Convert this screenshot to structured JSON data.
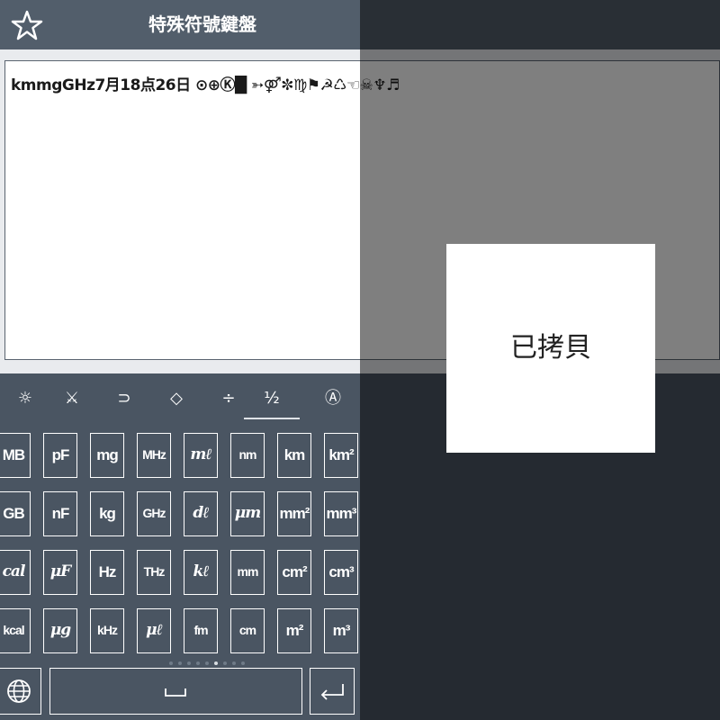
{
  "app": {
    "title": "特殊符號鍵盤"
  },
  "editor": {
    "text": "kmmgGHz7月18点26日 ⊙⊕Ⓚ█ ➳⚤✼♍⚑☭♺☜☠♆♬"
  },
  "tabs": [
    {
      "name": "tab-symbols",
      "glyph": "☼"
    },
    {
      "name": "tab-swords",
      "glyph": "⚔"
    },
    {
      "name": "tab-arrows",
      "glyph": "⊃"
    },
    {
      "name": "tab-shapes",
      "glyph": "◇"
    },
    {
      "name": "tab-math",
      "glyph": "÷"
    },
    {
      "name": "tab-units",
      "glyph": "½",
      "active": true
    },
    {
      "name": "tab-letters",
      "glyph": "Ⓐ"
    }
  ],
  "keys": [
    [
      "MB",
      "pF",
      "mg",
      "MHz",
      "mℓ",
      "nm",
      "km",
      "km²"
    ],
    [
      "GB",
      "nF",
      "kg",
      "GHz",
      "dℓ",
      "μm",
      "mm²",
      "mm³"
    ],
    [
      "cal",
      "μF",
      "Hz",
      "THz",
      "kℓ",
      "mm",
      "cm²",
      "cm³"
    ],
    [
      "kcal",
      "μg",
      "kHz",
      "μℓ",
      "fm",
      "cm",
      "m²",
      "m³"
    ]
  ],
  "bottom": {
    "globe": "🌐",
    "space": "⎵",
    "enter": "↵"
  },
  "toast": {
    "text": "已拷貝"
  },
  "colors": {
    "bar": "#525e6b",
    "keyboard": "#4a5562",
    "editor": "#ffffff"
  }
}
